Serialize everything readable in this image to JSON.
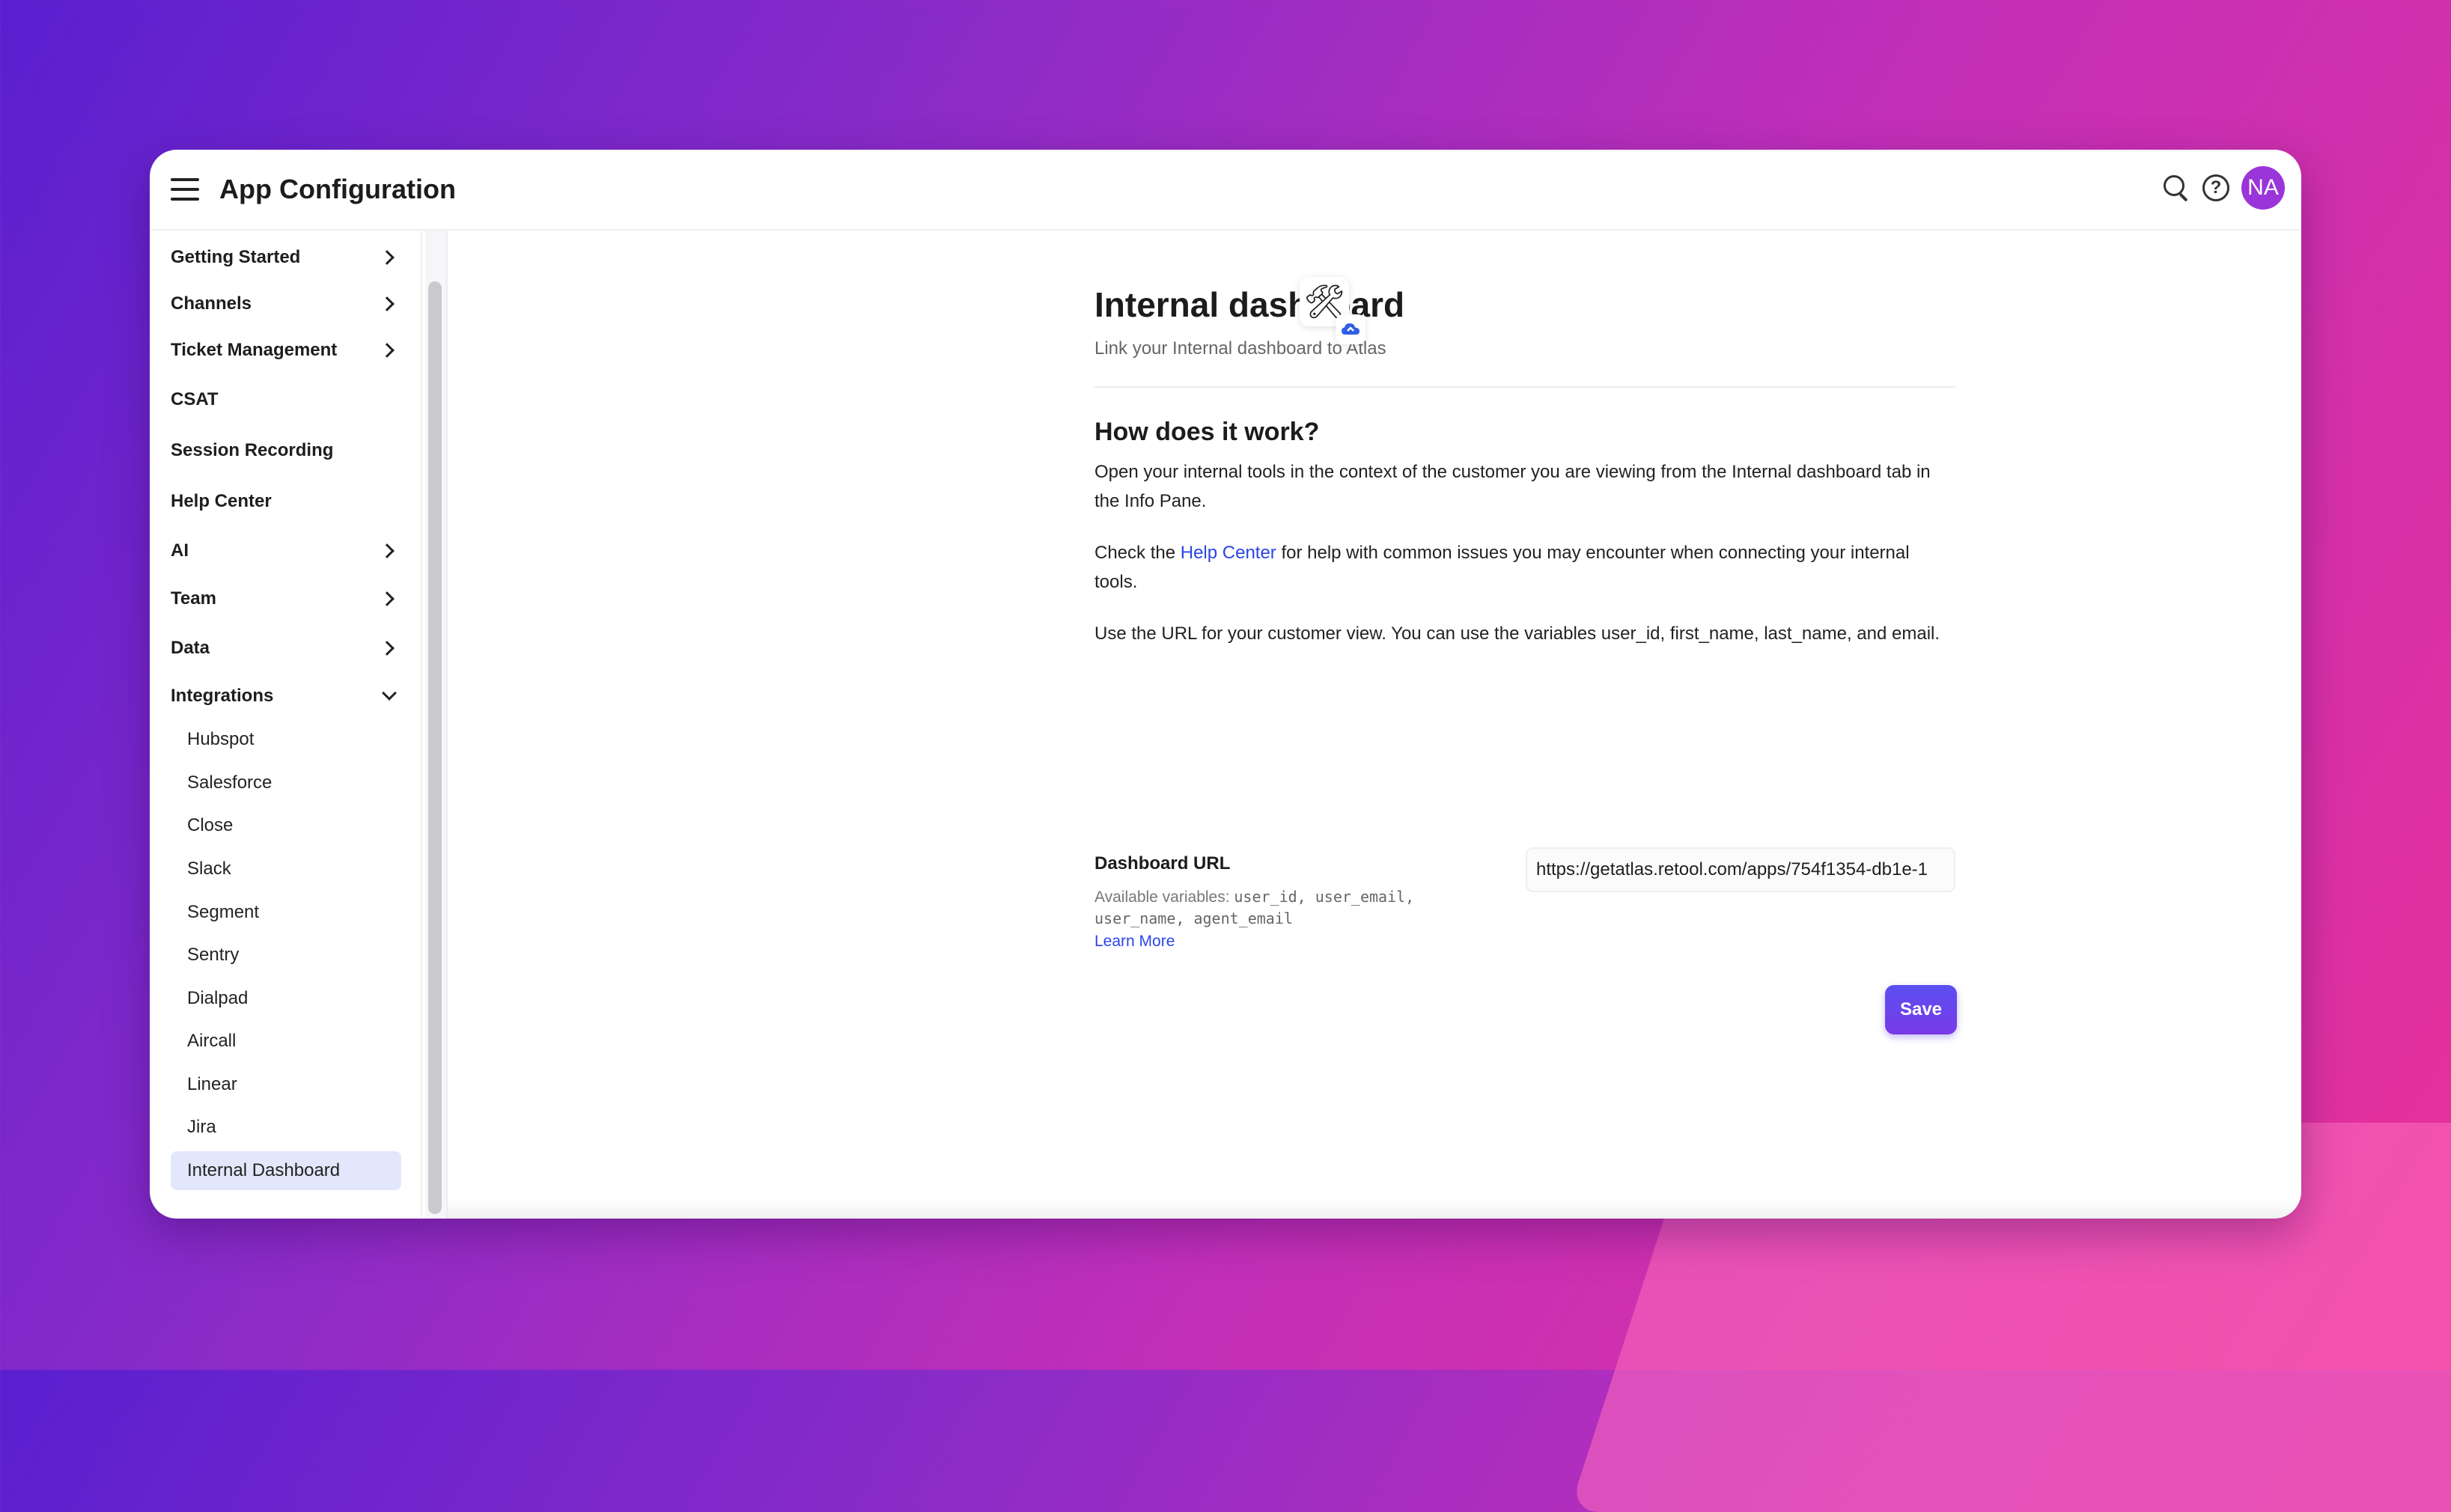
{
  "header": {
    "title": "App Configuration",
    "avatar_initials": "NA"
  },
  "sidebar": {
    "items": [
      {
        "label": "Getting Started",
        "chevron": "right"
      },
      {
        "label": "Channels",
        "chevron": "right"
      },
      {
        "label": "Ticket Management",
        "chevron": "right"
      },
      {
        "label": "CSAT",
        "chevron": "none"
      },
      {
        "label": "Session Recording",
        "chevron": "none"
      },
      {
        "label": "Help Center",
        "chevron": "none"
      },
      {
        "label": "AI",
        "chevron": "right"
      },
      {
        "label": "Team",
        "chevron": "right"
      },
      {
        "label": "Data",
        "chevron": "right"
      },
      {
        "label": "Integrations",
        "chevron": "down"
      }
    ],
    "integrations": [
      "Hubspot",
      "Salesforce",
      "Close",
      "Slack",
      "Segment",
      "Sentry",
      "Dialpad",
      "Aircall",
      "Linear",
      "Jira",
      "Internal Dashboard"
    ],
    "active_item": "Internal Dashboard"
  },
  "main": {
    "title": "Internal dashboard",
    "subtitle": "Link your Internal dashboard to Atlas",
    "section_title": "How does it work?",
    "para1": "Open your internal tools in the context of the customer you are viewing from the Internal dashboard tab in the Info Pane.",
    "para2_prefix": "Check the ",
    "para2_link": "Help Center",
    "para2_suffix": " for help with common issues you may encounter when connecting your internal tools.",
    "para3": "Use the URL for your customer view. You can use the variables user_id, first_name, last_name, and email.",
    "field": {
      "label": "Dashboard URL",
      "help_prefix": "Available variables: ",
      "help_vars": "user_id, user_email, user_name, agent_email",
      "learn_more": "Learn More",
      "value": "https://getatlas.retool.com/apps/754f1354-db1e-1"
    },
    "save_label": "Save"
  },
  "colors": {
    "accent": "#2b45e6",
    "save_button": "#5a4ff0",
    "avatar": "#9a35d9",
    "active_nav_bg": "#e2e7fb"
  }
}
